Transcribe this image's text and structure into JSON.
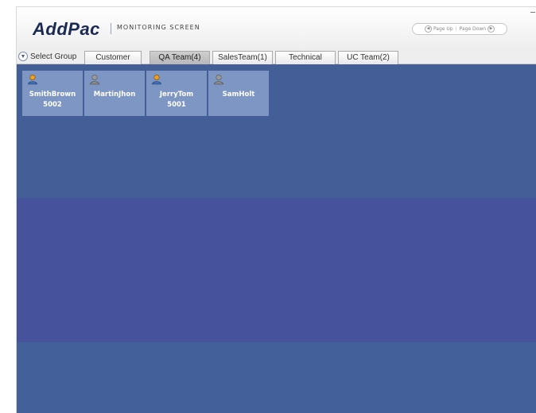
{
  "header": {
    "logo": "AddPac",
    "screen_title": "MONITORING SCREEN",
    "page_up": "Page Up",
    "page_down": "Page Down"
  },
  "tabbar": {
    "select_group": "Select Group",
    "tabs": [
      {
        "label": "Customer",
        "active": false
      },
      {
        "label": "QA Team(4)",
        "active": true
      },
      {
        "label": "SalesTeam(1)",
        "active": false
      },
      {
        "label": "Technical",
        "active": false
      },
      {
        "label": "UC Team(2)",
        "active": false
      }
    ]
  },
  "agents": [
    {
      "name": "SmithBrown",
      "ext": "5002",
      "status": "active"
    },
    {
      "name": "MartinJhon",
      "ext": "",
      "status": "idle"
    },
    {
      "name": "JerryTom",
      "ext": "5001",
      "status": "active"
    },
    {
      "name": "SamHolt",
      "ext": "",
      "status": "idle"
    }
  ],
  "colors": {
    "accent": "#1b2a52",
    "card": "#7e96c4",
    "content_band_1": "#445f97",
    "content_band_2": "#46529b",
    "content_band_3": "#44609a",
    "agent_active": "#f0a020",
    "agent_idle": "#9a9a9a"
  }
}
